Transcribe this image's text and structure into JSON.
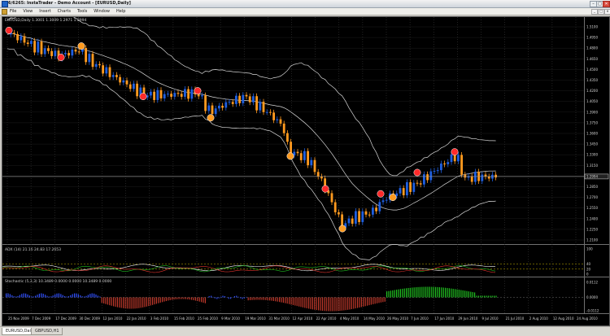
{
  "window": {
    "title": "6/6265: InstaTrader - Demo Account - [EURUSD,Daily]",
    "controls": {
      "minimize": "–",
      "maximize": "□",
      "close": "✕"
    },
    "doc_controls": {
      "minimize": "_",
      "maximize": "□",
      "close": "x"
    }
  },
  "menu": {
    "items": [
      "File",
      "View",
      "Insert",
      "Charts",
      "Tools",
      "Window",
      "Help"
    ]
  },
  "chart": {
    "symbol_header": "EURUSD,Daily 1.3001 1.3009 1.2971 1.2994",
    "adx_header": "ADX (14) 21.16 24.83 17.2653",
    "osc_header": "Stochastic (5,3,3) 10.3489 0.0000 0.0000 10.3489 0.0000",
    "colors": {
      "background": "#000000",
      "bull_candle": "#1f5fe0",
      "bear_candle": "#ff9a1f",
      "bands": "#d8d8d8",
      "grid": "#3a3a3a",
      "adx_main": "#ffffff",
      "di_plus": "#1fbe1f",
      "di_minus": "#e0332c",
      "hist_pos": "#20c020",
      "hist_neg": "#c0392b",
      "hist_neutral": "#3050ff",
      "marker_red": "#ff2a2a",
      "marker_orange": "#ff9a1f"
    },
    "price_axis": [
      "1.5100",
      "1.4950",
      "1.4800",
      "1.4650",
      "1.4500",
      "1.4350",
      "1.4200",
      "1.4050",
      "1.3900",
      "1.3750",
      "1.3600",
      "1.3450",
      "1.3300",
      "1.3150",
      "1.3000",
      "1.2850",
      "1.2700",
      "1.2550",
      "1.2400",
      "1.2250",
      "1.2100"
    ],
    "current_price": "1.2994",
    "adx_axis": [
      "100",
      "40",
      "20",
      "0"
    ],
    "osc_axis": [
      "0.0112",
      "0.0000",
      "-0.0112"
    ],
    "date_axis": [
      "25 Nov 2009",
      "7 Dec 2009",
      "17 Dec 2009",
      "30 Dec 2009",
      "12 Jan 2010",
      "22 Jan 2010",
      "3 Feb 2010",
      "15 Feb 2010",
      "25 Feb 2010",
      "9 Mar 2010",
      "19 Mar 2010",
      "31 Mar 2010",
      "12 Apr 2010",
      "22 Apr 2010",
      "4 May 2010",
      "14 May 2010",
      "26 May 2010",
      "7 Jun 2010",
      "17 Jun 2010",
      "29 Jun 2010",
      "9 Jul 2010",
      "21 Jul 2010",
      "2 Aug 2010",
      "12 Aug 2010",
      "24 Aug 2010"
    ]
  },
  "tabs": {
    "items": [
      "EURUSD,Daily",
      "GBPUSD,H1"
    ],
    "active_index": 0
  }
}
